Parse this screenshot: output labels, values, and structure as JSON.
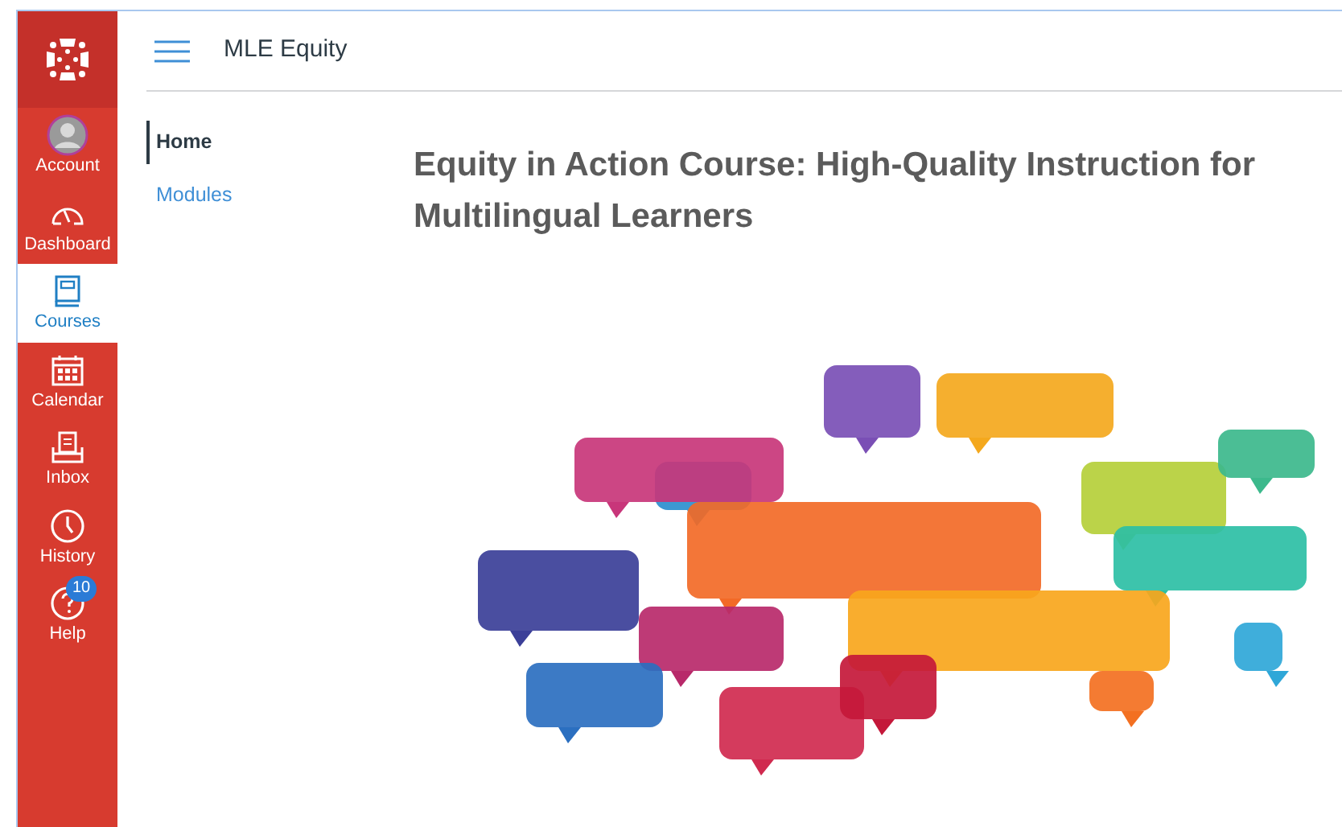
{
  "global_nav": [
    {
      "kind": "account",
      "label": "Account",
      "selected": false
    },
    {
      "kind": "dashboard",
      "label": "Dashboard",
      "selected": false
    },
    {
      "kind": "courses",
      "label": "Courses",
      "selected": true
    },
    {
      "kind": "calendar",
      "label": "Calendar",
      "selected": false
    },
    {
      "kind": "inbox",
      "label": "Inbox",
      "selected": false
    },
    {
      "kind": "history",
      "label": "History",
      "selected": false
    },
    {
      "kind": "help",
      "label": "Help",
      "selected": false,
      "badge": "10"
    }
  ],
  "header": {
    "title": "MLE Equity"
  },
  "course_nav": [
    {
      "label": "Home",
      "selected": true
    },
    {
      "label": "Modules",
      "selected": false
    }
  ],
  "page": {
    "heading": "Equity in Action Course: High-Quality Instruction for Multilingual Learners"
  }
}
